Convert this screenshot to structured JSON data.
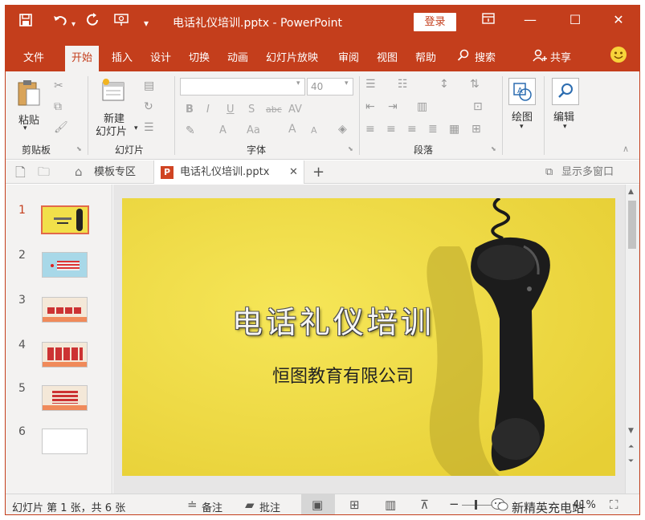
{
  "titlebar": {
    "doc_title": "电话礼仪培训.pptx  -  PowerPoint",
    "login": "登录",
    "save_icon": "save-icon",
    "undo_icon": "undo-icon",
    "redo_icon": "redo-icon"
  },
  "tabs": [
    "文件",
    "开始",
    "插入",
    "设计",
    "切换",
    "动画",
    "幻灯片放映",
    "审阅",
    "视图",
    "帮助",
    "搜索",
    "共享"
  ],
  "active_tab": "开始",
  "ribbon": {
    "clipboard": {
      "paste": "粘贴",
      "group": "剪贴板"
    },
    "slides": {
      "new_line1": "新建",
      "new_line2": "幻灯片",
      "group": "幻灯片"
    },
    "font": {
      "font_name": "",
      "font_size": "40",
      "group": "字体",
      "bold": "B",
      "italic": "I",
      "underline": "U",
      "shadow": "S",
      "strike": "abc",
      "spacing": "AV",
      "color": "A",
      "case": "Aa",
      "grow": "A",
      "shrink": "A"
    },
    "paragraph": {
      "group": "段落"
    },
    "drawing": {
      "label": "绘图"
    },
    "editing": {
      "label": "编辑"
    }
  },
  "docbar": {
    "template_tab": "模板专区",
    "file_tab": "电话礼仪培训.pptx",
    "multi_window": "显示多窗口"
  },
  "thumbnails": [
    {
      "num": "1",
      "current": true
    },
    {
      "num": "2",
      "current": false
    },
    {
      "num": "3",
      "current": false
    },
    {
      "num": "4",
      "current": false
    },
    {
      "num": "5",
      "current": false
    },
    {
      "num": "6",
      "current": false
    }
  ],
  "slide": {
    "title": "电话礼仪培训",
    "subtitle": "恒图教育有限公司"
  },
  "status": {
    "slide_info": "幻灯片 第 1 张，共 6 张",
    "notes": "备注",
    "comments": "批注",
    "watermark": "新精英充电站",
    "zoom": "41%"
  },
  "colors": {
    "accent": "#c43e1c",
    "slide_bg": "#f1e04a"
  }
}
